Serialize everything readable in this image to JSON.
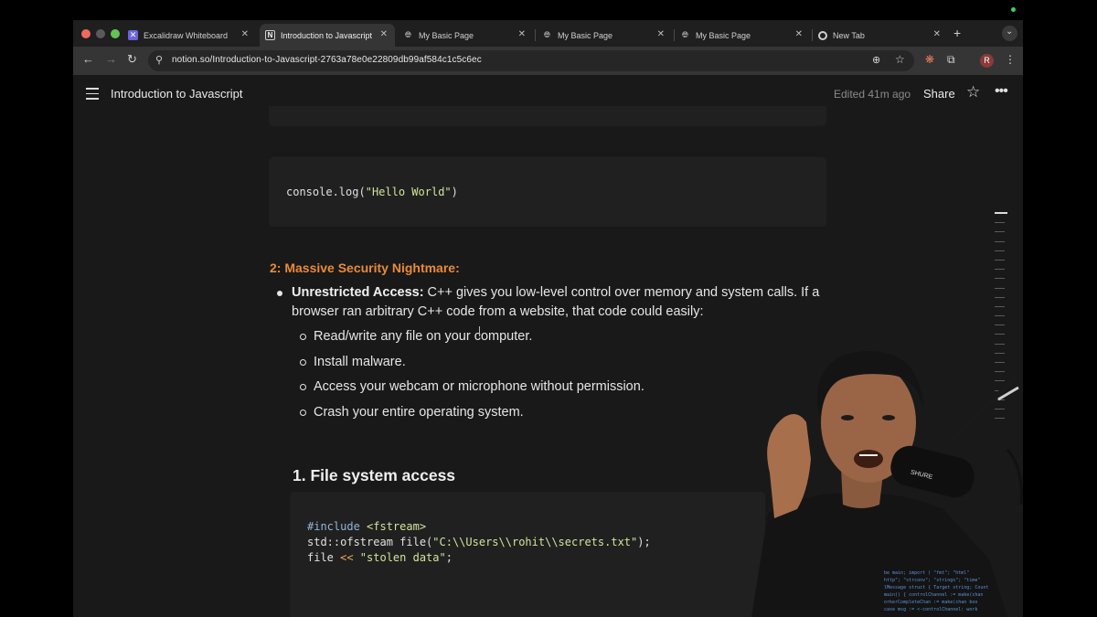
{
  "tabs": [
    {
      "label": "Excalidraw Whiteboard",
      "icon": "excalidraw-icon",
      "active": false
    },
    {
      "label": "Introduction to Javascript",
      "icon": "notion-icon",
      "active": true
    },
    {
      "label": "My Basic Page",
      "icon": "globe-icon",
      "active": false
    },
    {
      "label": "My Basic Page",
      "icon": "globe-icon",
      "active": false
    },
    {
      "label": "My Basic Page",
      "icon": "globe-icon",
      "active": false
    },
    {
      "label": "New Tab",
      "icon": "chrome-icon",
      "active": false
    }
  ],
  "address": {
    "url": "notion.so/Introduction-to-Javascript-2763a78e0e22809db99af584c1c5c6ec"
  },
  "profile": {
    "initial": "R"
  },
  "notion": {
    "title": "Introduction to Javascript",
    "edited": "Edited 41m ago",
    "share": "Share"
  },
  "content": {
    "code1": {
      "fn": "console.",
      "method": "log",
      "open": "(",
      "arg": "\"Hello World\"",
      "close": ")"
    },
    "section_heading": "2: Massive Security Nightmare:",
    "bullet": {
      "bold": "Unrestricted Access:",
      "text_line1": " C++ gives you low-level control over memory and system calls. If a",
      "text_line2": "browser ran arbitrary C++ code from a website, that code could easily:"
    },
    "subitems": [
      "Read/write any file on your computer.",
      "Install malware.",
      "Access your webcam or microphone without permission.",
      "Crash your entire operating system."
    ],
    "subheading": "1. File system access",
    "code2": {
      "line1_kw": "#include",
      "line1_rest": " <fstream>",
      "line2_a": "std::ofstream file(",
      "line2_str": "\"C:\\\\Users\\\\rohit\\\\secrets.txt\"",
      "line2_b": ");",
      "line3_a": "file ",
      "line3_op": "<<",
      "line3_str": " \"stolen data\"",
      "line3_b": ";"
    }
  },
  "mic_brand": "SHURE",
  "colors": {
    "accent_heading": "#e88a3a",
    "string": "#cfe59a",
    "keyword": "#8fb6d8",
    "background": "#191919"
  }
}
